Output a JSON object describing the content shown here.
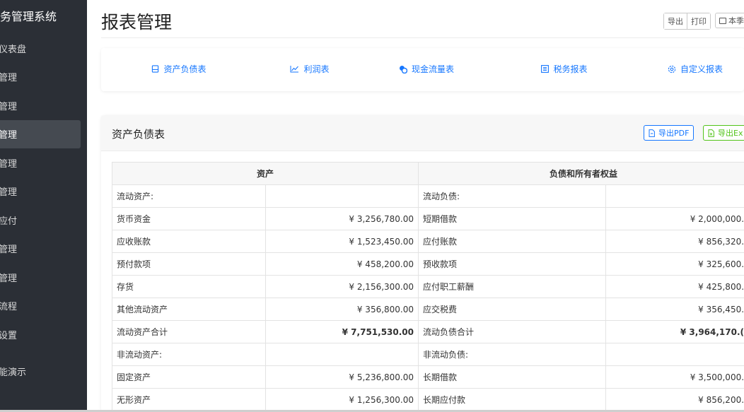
{
  "sidebar": {
    "brand": "务管理系统",
    "items": [
      {
        "label": "仪表盘",
        "active": false
      },
      {
        "label": "管理",
        "active": false
      },
      {
        "label": "管理",
        "active": false
      },
      {
        "label": "管理",
        "active": true
      },
      {
        "label": "管理",
        "active": false
      },
      {
        "label": "管理",
        "active": false
      },
      {
        "label": "应付",
        "active": false
      },
      {
        "label": "管理",
        "active": false
      },
      {
        "label": "管理",
        "active": false
      },
      {
        "label": "流程",
        "active": false
      },
      {
        "label": "设置",
        "active": false
      },
      {
        "label": "能演示",
        "active": false
      }
    ]
  },
  "header": {
    "title": "报表管理",
    "export_label": "导出",
    "print_label": "打印",
    "date_label": "本季"
  },
  "tabs": [
    {
      "label": "资产负债表",
      "icon": "balance-sheet-icon",
      "active": true
    },
    {
      "label": "利润表",
      "icon": "line-chart-icon",
      "active": false
    },
    {
      "label": "现金流量表",
      "icon": "cash-flow-icon",
      "active": false
    },
    {
      "label": "税务报表",
      "icon": "tax-report-icon",
      "active": false
    },
    {
      "label": "自定义报表",
      "icon": "settings-icon",
      "active": false
    }
  ],
  "report": {
    "title": "资产负债表",
    "export_pdf": "导出PDF",
    "export_excel": "导出Ex",
    "columns": {
      "assets": "资产",
      "liabilities": "负债和所有者权益"
    },
    "rows": [
      {
        "type": "section",
        "left": "流动资产:",
        "left_value": "",
        "right": "流动负债:",
        "right_value": ""
      },
      {
        "type": "item",
        "left": "货币资金",
        "left_value": "¥ 3,256,780.00",
        "right": "短期借款",
        "right_value": "¥ 2,000,000."
      },
      {
        "type": "item",
        "left": "应收账款",
        "left_value": "¥ 1,523,450.00",
        "right": "应付账款",
        "right_value": "¥ 856,320."
      },
      {
        "type": "item",
        "left": "预付款项",
        "left_value": "¥ 458,200.00",
        "right": "预收款项",
        "right_value": "¥ 325,600."
      },
      {
        "type": "item",
        "left": "存货",
        "left_value": "¥ 2,156,300.00",
        "right": "应付职工薪酬",
        "right_value": "¥ 425,800."
      },
      {
        "type": "item",
        "left": "其他流动资产",
        "left_value": "¥ 356,800.00",
        "right": "应交税费",
        "right_value": "¥ 356,450."
      },
      {
        "type": "total",
        "left": "流动资产合计",
        "left_value": "¥ 7,751,530.00",
        "right": "流动负债合计",
        "right_value": "¥ 3,964,170.("
      },
      {
        "type": "section",
        "left": "非流动资产:",
        "left_value": "",
        "right": "非流动负债:",
        "right_value": ""
      },
      {
        "type": "item",
        "left": "固定资产",
        "left_value": "¥ 5,236,800.00",
        "right": "长期借款",
        "right_value": "¥ 3,500,000."
      },
      {
        "type": "item",
        "left": "无形资产",
        "left_value": "¥ 1,256,300.00",
        "right": "长期应付款",
        "right_value": "¥ 856,200."
      }
    ]
  },
  "colors": {
    "sidebar_bg": "#2b2f36",
    "accent": "#1677ff",
    "excel_green": "#52c41a"
  }
}
